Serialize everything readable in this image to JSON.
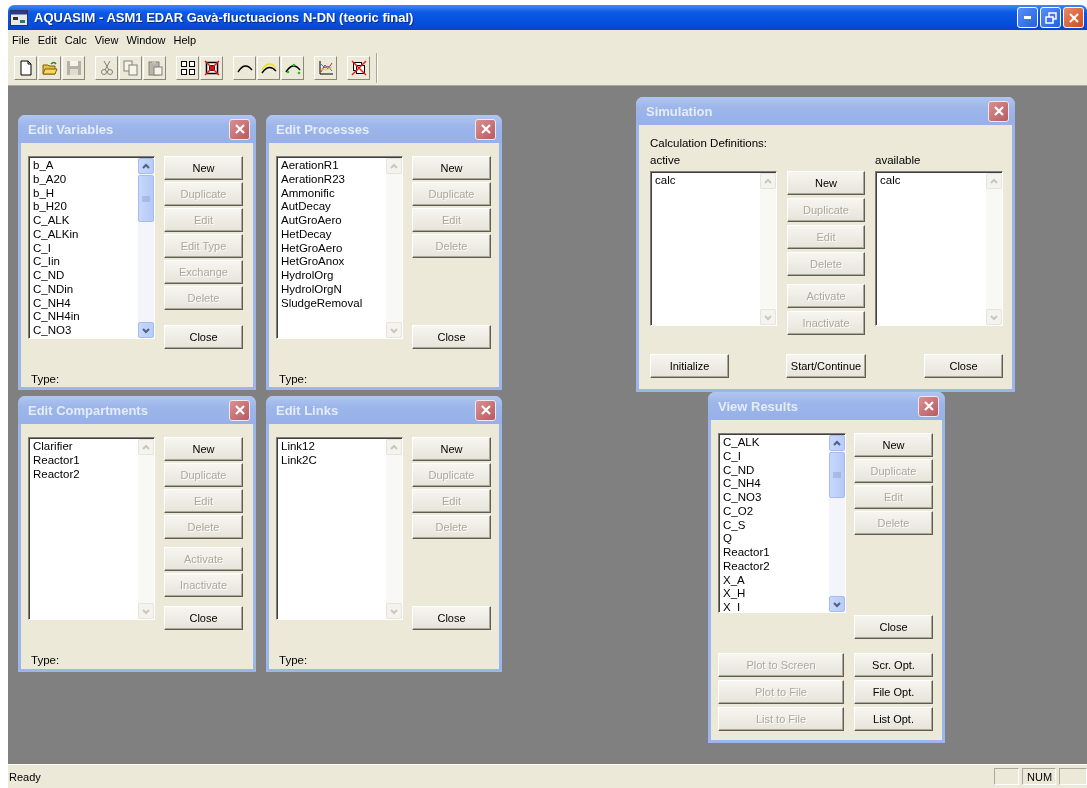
{
  "window": {
    "title": "AQUASIM - ASM1 EDAR Gavà-fluctuacions N-DN (teoric final)"
  },
  "menu": [
    "File",
    "Edit",
    "Calc",
    "View",
    "Window",
    "Help"
  ],
  "toolbar": {
    "groups": [
      [
        {
          "kind": "new",
          "disabled": false
        },
        {
          "kind": "open",
          "disabled": false
        },
        {
          "kind": "save",
          "disabled": true
        }
      ],
      [
        {
          "kind": "cut",
          "disabled": true
        },
        {
          "kind": "copy",
          "disabled": true
        },
        {
          "kind": "paste",
          "disabled": true
        }
      ],
      [
        {
          "kind": "tile",
          "disabled": false
        },
        {
          "kind": "close-windows",
          "disabled": false
        }
      ],
      [
        {
          "kind": "curve",
          "disabled": false
        },
        {
          "kind": "curve-band",
          "disabled": false
        },
        {
          "kind": "curve-points",
          "disabled": false
        }
      ],
      [
        {
          "kind": "plot",
          "disabled": false
        }
      ],
      [
        {
          "kind": "delete-plots",
          "disabled": false
        }
      ]
    ]
  },
  "windows": [
    {
      "kind": "editor",
      "title": "Edit Variables",
      "list": {
        "items": [
          "b_A",
          "b_A20",
          "b_H",
          "b_H20",
          "C_ALK",
          "C_ALKin",
          "C_I",
          "C_Iin",
          "C_ND",
          "C_NDin",
          "C_NH4",
          "C_NH4in",
          "C_NO3"
        ],
        "scrollbar_enabled": true
      },
      "button_groups": [
        [
          {
            "label": "New",
            "disabled": false
          },
          {
            "label": "Duplicate",
            "disabled": true
          },
          {
            "label": "Edit",
            "disabled": true
          },
          {
            "label": "Edit Type",
            "disabled": true
          },
          {
            "label": "Exchange",
            "disabled": true
          },
          {
            "label": "Delete",
            "disabled": true
          }
        ],
        [
          {
            "label": "Close",
            "disabled": false
          }
        ]
      ],
      "type_label": "Type:"
    },
    {
      "kind": "editor",
      "title": "Edit Processes",
      "list": {
        "items": [
          "AerationR1",
          "AerationR23",
          "Ammonific",
          "AutDecay",
          "AutGroAero",
          "HetDecay",
          "HetGroAero",
          "HetGroAnox",
          "HydrolOrg",
          "HydrolOrgN",
          "SludgeRemoval"
        ],
        "scrollbar_enabled": false
      },
      "button_groups": [
        [
          {
            "label": "New",
            "disabled": false
          },
          {
            "label": "Duplicate",
            "disabled": true
          },
          {
            "label": "Edit",
            "disabled": true
          },
          {
            "label": "Delete",
            "disabled": true
          }
        ],
        [
          {
            "label": "Close",
            "disabled": false
          }
        ]
      ],
      "type_label": "Type:"
    },
    {
      "kind": "editor",
      "title": "Edit Compartments",
      "list": {
        "items": [
          "Clarifier",
          "Reactor1",
          "Reactor2"
        ],
        "scrollbar_enabled": false
      },
      "button_groups": [
        [
          {
            "label": "New",
            "disabled": false
          },
          {
            "label": "Duplicate",
            "disabled": true
          },
          {
            "label": "Edit",
            "disabled": true
          },
          {
            "label": "Delete",
            "disabled": true
          }
        ],
        [
          {
            "label": "Activate",
            "disabled": true
          },
          {
            "label": "Inactivate",
            "disabled": true
          }
        ],
        [
          {
            "label": "Close",
            "disabled": false
          }
        ]
      ],
      "type_label": "Type:"
    },
    {
      "kind": "editor",
      "title": "Edit Links",
      "list": {
        "items": [
          "Link12",
          "Link2C"
        ],
        "scrollbar_enabled": false
      },
      "button_groups": [
        [
          {
            "label": "New",
            "disabled": false
          },
          {
            "label": "Duplicate",
            "disabled": true
          },
          {
            "label": "Edit",
            "disabled": true
          },
          {
            "label": "Delete",
            "disabled": true
          }
        ],
        [
          {
            "label": "Close",
            "disabled": false
          }
        ]
      ],
      "type_label": "Type:"
    },
    {
      "kind": "simulation",
      "title": "Simulation",
      "heading": "Calculation Definitions:",
      "lists": [
        {
          "label": "active",
          "items": [
            "calc"
          ],
          "scrollbar_enabled": false
        },
        {
          "label": "available",
          "items": [
            "calc"
          ],
          "scrollbar_enabled": false
        }
      ],
      "button_groups": [
        [
          {
            "label": "New",
            "disabled": false
          },
          {
            "label": "Duplicate",
            "disabled": true
          },
          {
            "label": "Edit",
            "disabled": true
          },
          {
            "label": "Delete",
            "disabled": true
          }
        ],
        [
          {
            "label": "Activate",
            "disabled": true
          },
          {
            "label": "Inactivate",
            "disabled": true
          }
        ]
      ],
      "footer_buttons": [
        {
          "label": "Initialize",
          "disabled": false
        },
        {
          "label": "Start/Continue",
          "disabled": false
        },
        {
          "label": "Close",
          "disabled": false
        }
      ]
    },
    {
      "kind": "results",
      "title": "View Results",
      "list": {
        "items": [
          "C_ALK",
          "C_I",
          "C_ND",
          "C_NH4",
          "C_NO3",
          "C_O2",
          "C_S",
          "Q",
          "Reactor1",
          "Reactor2",
          "X_A",
          "X_H",
          "X_I"
        ],
        "scrollbar_enabled": true
      },
      "button_groups": [
        [
          {
            "label": "New",
            "disabled": false
          },
          {
            "label": "Duplicate",
            "disabled": true
          },
          {
            "label": "Edit",
            "disabled": true
          },
          {
            "label": "Delete",
            "disabled": true
          }
        ],
        [
          {
            "label": "Close",
            "disabled": false
          }
        ]
      ],
      "output_buttons": [
        {
          "label": "Plot to Screen",
          "disabled": true
        },
        {
          "label": "Plot to File",
          "disabled": true
        },
        {
          "label": "List to File",
          "disabled": true
        }
      ],
      "option_buttons": [
        {
          "label": "Scr. Opt.",
          "disabled": false
        },
        {
          "label": "File Opt.",
          "disabled": false
        },
        {
          "label": "List Opt.",
          "disabled": false
        }
      ]
    }
  ],
  "status_bar": {
    "message": "Ready",
    "indicators": [
      "NUM"
    ]
  }
}
